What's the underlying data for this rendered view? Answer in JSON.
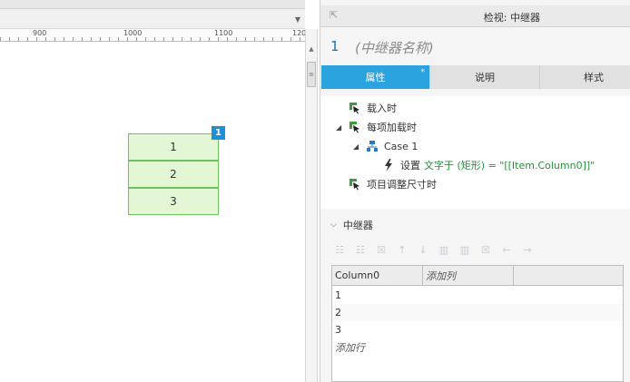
{
  "canvas": {
    "ruler": {
      "labels": [
        "900",
        "1000",
        "1100",
        "120"
      ]
    },
    "repeater": {
      "badge": "1",
      "items": [
        "1",
        "2",
        "3"
      ]
    }
  },
  "inspector": {
    "title": "检视: 中继器",
    "widget_index": "1",
    "widget_name": "(中继器名称)",
    "tabs": [
      {
        "label": "属性",
        "active": true,
        "marker": "*"
      },
      {
        "label": "说明",
        "active": false
      },
      {
        "label": "样式",
        "active": false
      }
    ],
    "interactions": {
      "on_load": "载入时",
      "on_item_load": "每项加载时",
      "case": "Case 1",
      "action_prefix": "设置",
      "action_detail": "文字于 (矩形) = \"[[Item.Column0]]\"",
      "on_item_resize": "项目调整尺寸时"
    },
    "section": {
      "title": "中继器"
    },
    "toolbar_icons": [
      "insert-row-icon",
      "insert-row-after-icon",
      "delete-row-icon",
      "move-up-icon",
      "move-down-icon",
      "insert-column-icon",
      "insert-column-after-icon",
      "delete-column-icon",
      "move-left-icon",
      "move-right-icon"
    ],
    "dataset": {
      "columns": [
        "Column0",
        "添加列"
      ],
      "rows": [
        "1",
        "2",
        "3"
      ],
      "add_row": "添加行"
    }
  },
  "colors": {
    "accent": "#2aa3df",
    "badge": "#1e90d6",
    "cell_fill": "#e4f7d4",
    "cell_border": "#6dc061",
    "green_text": "#23933a"
  }
}
